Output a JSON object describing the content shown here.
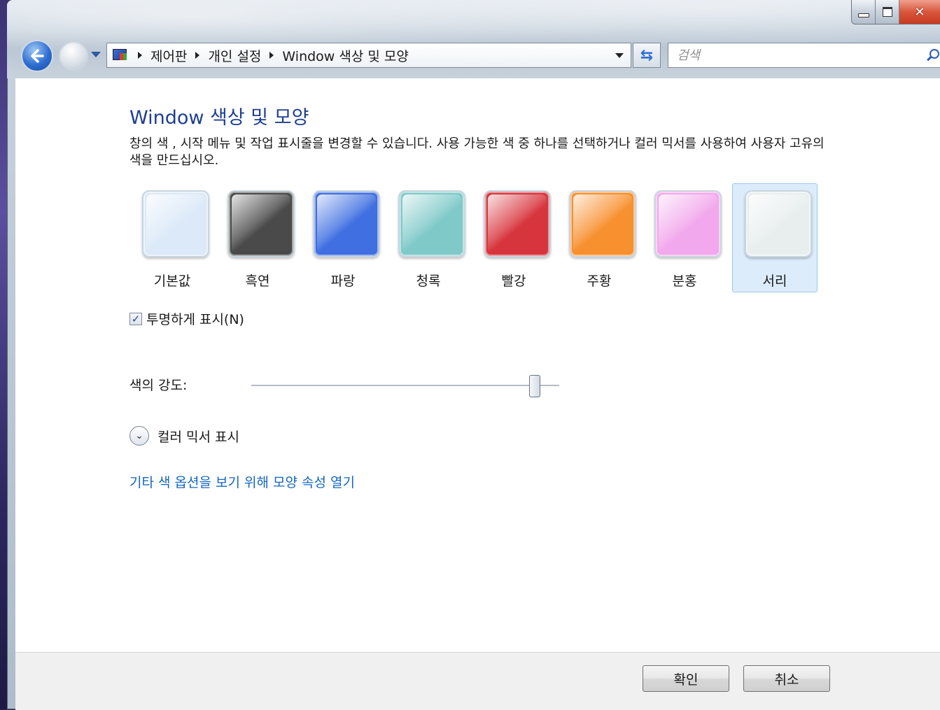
{
  "window": {
    "caption": {
      "minimize_icon": "minimize-icon",
      "maximize_icon": "maximize-icon",
      "close_icon": "close-icon",
      "close_glyph": "✕"
    }
  },
  "nav": {
    "breadcrumbs": [
      "제어판",
      "개인 설정",
      "Window 색상 및 모양"
    ],
    "search_placeholder": "검색"
  },
  "main": {
    "title": "Window 색상 및 모양",
    "description": "창의 색 , 시작 메뉴 및 작업 표시줄을 변경할 수 있습니다. 사용 가능한 색 중 하나를 선택하거나 컬러 믹서를 사용하여 사용자 고유의 색을 만드십시오.",
    "swatches": [
      {
        "label": "기본값",
        "color": "#dbe9f8",
        "selected": false
      },
      {
        "label": "흑연",
        "color": "#4a4a4a",
        "selected": false
      },
      {
        "label": "파랑",
        "color": "#3f6fe0",
        "selected": false
      },
      {
        "label": "청록",
        "color": "#7fc9c9",
        "selected": false
      },
      {
        "label": "빨강",
        "color": "#d7353d",
        "selected": false
      },
      {
        "label": "주황",
        "color": "#f7902e",
        "selected": false
      },
      {
        "label": "분홍",
        "color": "#f2a8ec",
        "selected": false
      },
      {
        "label": "서리",
        "color": "#e8eeee",
        "selected": true
      }
    ],
    "transparency": {
      "label": "투명하게 표시(N)",
      "checked": true,
      "check_glyph": "✓"
    },
    "intensity": {
      "label": "색의 강도:",
      "value_fraction": 0.92
    },
    "mixer": {
      "label": "컬러 믹서 표시",
      "chevron_glyph": "⌄"
    },
    "more_link": "기타 색 옵션을 보기 위해 모양 속성 열기"
  },
  "footer": {
    "ok_label": "확인",
    "cancel_label": "취소"
  }
}
